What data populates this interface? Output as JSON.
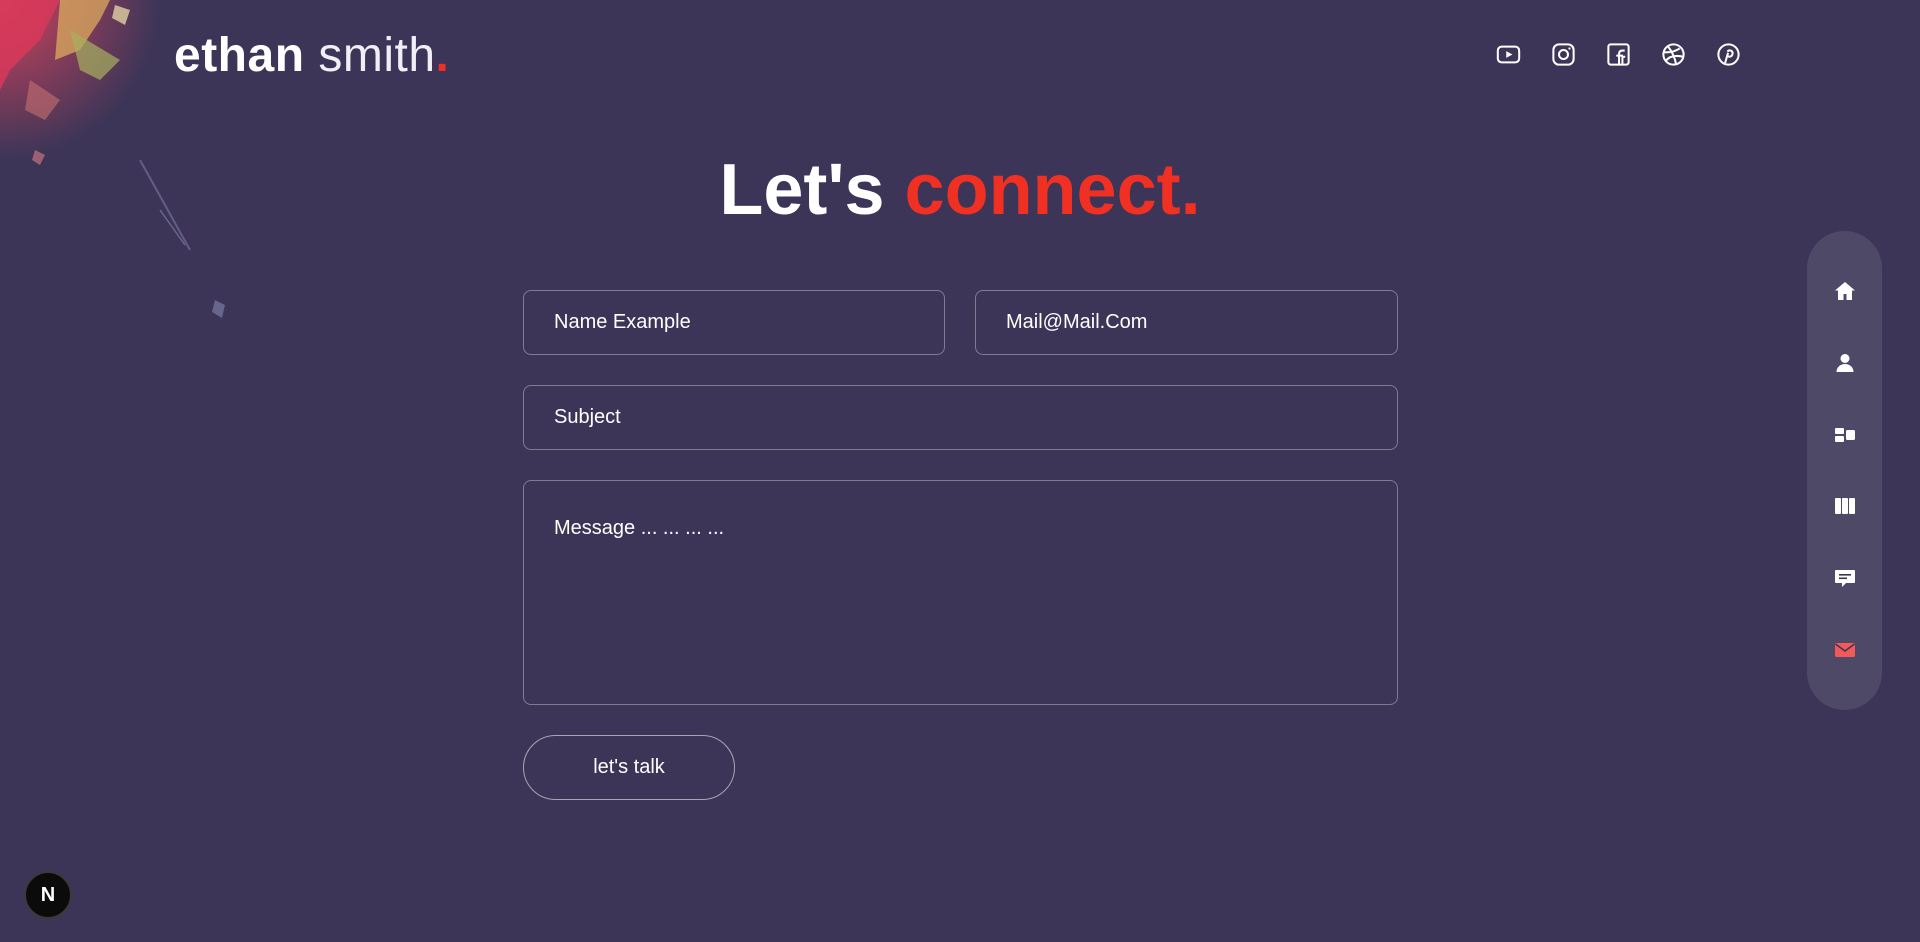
{
  "header": {
    "logo_first": "ethan",
    "logo_last": "smith",
    "logo_dot": ".",
    "socials": [
      {
        "icon": "youtube-icon"
      },
      {
        "icon": "instagram-icon"
      },
      {
        "icon": "facebook-icon"
      },
      {
        "icon": "dribbble-icon"
      },
      {
        "icon": "pinterest-icon"
      }
    ]
  },
  "hero": {
    "title_plain": "Let's ",
    "title_accent": "connect."
  },
  "form": {
    "name_placeholder": "Name Example",
    "email_placeholder": "Mail@Mail.Com",
    "subject_placeholder": "Subject",
    "message_placeholder": "Message ... ... ... ...",
    "submit_label": "let's talk"
  },
  "sidenav": {
    "items": [
      {
        "icon": "home-icon",
        "active": false
      },
      {
        "icon": "user-icon",
        "active": false
      },
      {
        "icon": "services-icon",
        "active": false
      },
      {
        "icon": "work-icon",
        "active": false
      },
      {
        "icon": "testimonials-icon",
        "active": false
      },
      {
        "icon": "contact-icon",
        "active": true
      }
    ]
  },
  "badge": {
    "label": "N"
  },
  "colors": {
    "background": "#3c3557",
    "accent": "#f13024",
    "active_nav": "#f13024"
  }
}
